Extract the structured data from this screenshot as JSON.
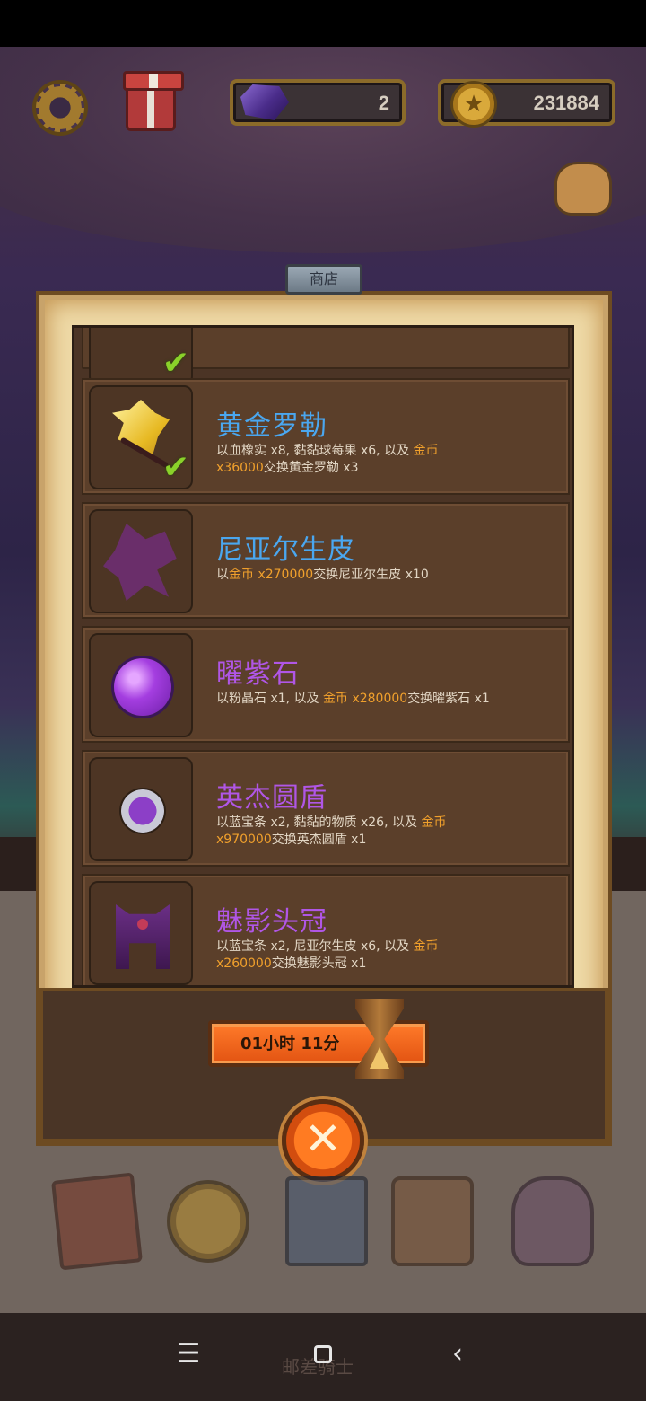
{
  "hud": {
    "gems": "2",
    "coins": "231884",
    "icons": [
      "gear-icon",
      "gift-icon",
      "gem-icon",
      "coin-icon",
      "bag-icon"
    ]
  },
  "shop": {
    "tab_label": "商店",
    "items": [
      {
        "name": "黄金罗勒",
        "desc_plain_1": "以血橡实 x8, 黏黏球莓果 x6, 以及 ",
        "desc_hl_1": "金币",
        "desc_hl_2": "x36000",
        "desc_plain_2": "交换黄金罗勒 x3",
        "owned": true
      },
      {
        "name": "尼亚尔生皮",
        "desc_plain_1": "以",
        "desc_hl_1": "金币 x270000",
        "desc_plain_2": "交换尼亚尔生皮 x10"
      },
      {
        "name": "曜紫石",
        "desc_plain_1": "以粉晶石 x1, 以及 ",
        "desc_hl_1": "金币 x280000",
        "desc_plain_2": "交换曜紫石 x1"
      },
      {
        "name": "英杰圆盾",
        "desc_plain_1": "以蓝宝条 x2, 黏黏的物质 x26, 以及 ",
        "desc_hl_1": "金币",
        "desc_hl_2": "x970000",
        "desc_plain_2": "交换英杰圆盾 x1"
      },
      {
        "name": "魅影头冠",
        "desc_plain_1": "以蓝宝条 x2, 尼亚尔生皮 x6, 以及 ",
        "desc_hl_1": "金币",
        "desc_hl_2": "x260000",
        "desc_plain_2": "交换魅影头冠 x1"
      }
    ],
    "timer": "01小时 11分",
    "close_glyph": "✕"
  },
  "bottom_label": "邮差骑士",
  "system_nav": {
    "menu": "☰",
    "back": "‹"
  },
  "colors": {
    "name_blue": "#4aa7f0",
    "name_purple": "#b056e6",
    "highlight": "#f0a02c",
    "check": "#8ad12a"
  }
}
